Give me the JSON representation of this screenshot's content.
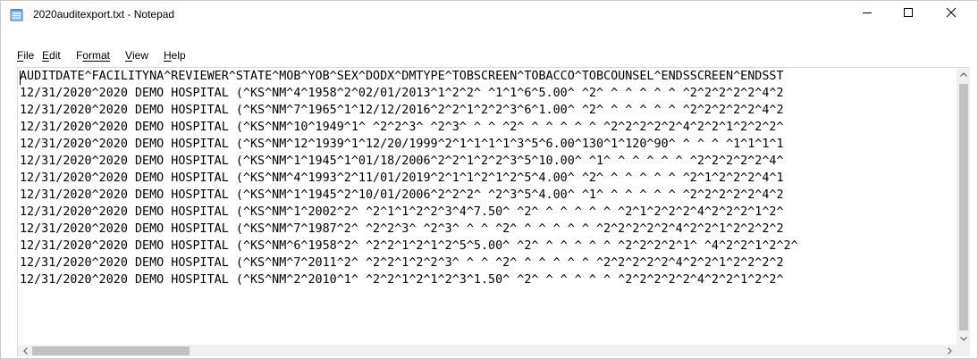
{
  "window": {
    "title": "2020auditexport.txt - Notepad",
    "controls": {
      "minimize": "—",
      "maximize": "☐",
      "close": "✕"
    }
  },
  "menu": {
    "items": [
      {
        "first": "F",
        "rest": "ile"
      },
      {
        "first": "E",
        "rest": "dit"
      },
      {
        "first": "F",
        "rest": "ormat",
        "prefix": ""
      },
      {
        "first": "V",
        "rest": "iew"
      },
      {
        "first": "H",
        "rest": "elp"
      }
    ]
  },
  "document": {
    "lines": [
      "AUDITDATE^FACILITYNA^REVIEWER^STATE^MOB^YOB^SEX^DODX^DMTYPE^TOBSCREEN^TOBACCO^TOBCOUNSEL^ENDSSCREEN^ENDSST",
      "12/31/2020^2020 DEMO HOSPITAL (^KS^NM^4^1958^2^02/01/2013^1^2^2^ ^1^1^6^5.00^ ^2^ ^ ^ ^ ^ ^ ^2^2^2^2^2^4^2",
      "12/31/2020^2020 DEMO HOSPITAL (^KS^NM^7^1965^1^12/12/2016^2^2^1^2^2^3^6^1.00^ ^2^ ^ ^ ^ ^ ^ ^2^2^2^2^2^4^2",
      "12/31/2020^2020 DEMO HOSPITAL (^KS^NM^10^1949^1^ ^2^2^3^ ^2^3^ ^ ^ ^2^ ^ ^ ^ ^ ^ ^2^2^2^2^2^4^2^2^1^2^2^2^",
      "12/31/2020^2020 DEMO HOSPITAL (^KS^NM^12^1939^1^12/20/1999^2^1^1^1^1^3^5^6.00^130^1^120^90^ ^ ^ ^ ^1^1^1^1",
      "12/31/2020^2020 DEMO HOSPITAL (^KS^NM^1^1945^1^01/18/2006^2^2^1^2^2^3^5^10.00^ ^1^ ^ ^ ^ ^ ^ ^2^2^2^2^2^4^",
      "12/31/2020^2020 DEMO HOSPITAL (^KS^NM^4^1993^2^11/01/2019^2^1^1^2^1^2^5^4.00^ ^2^ ^ ^ ^ ^ ^ ^2^1^2^2^2^4^1",
      "12/31/2020^2020 DEMO HOSPITAL (^KS^NM^1^1945^2^10/01/2006^2^2^2^ ^2^3^5^4.00^ ^1^ ^ ^ ^ ^ ^ ^2^2^2^2^2^4^2",
      "12/31/2020^2020 DEMO HOSPITAL (^KS^NM^1^2002^2^ ^2^1^1^2^2^3^4^7.50^ ^2^ ^ ^ ^ ^ ^ ^2^1^2^2^2^4^2^2^2^1^2^",
      "12/31/2020^2020 DEMO HOSPITAL (^KS^NM^7^1987^2^ ^2^2^3^ ^2^3^ ^ ^ ^2^ ^ ^ ^ ^ ^ ^2^2^2^2^2^4^2^2^1^2^2^2^2",
      "12/31/2020^2020 DEMO HOSPITAL (^KS^NM^6^1958^2^ ^2^2^1^2^1^2^5^5.00^ ^2^ ^ ^ ^ ^ ^ ^2^2^2^2^1^ ^4^2^2^1^2^2^",
      "12/31/2020^2020 DEMO HOSPITAL (^KS^NM^7^2011^2^ ^2^2^1^2^2^3^ ^ ^ ^2^ ^ ^ ^ ^ ^ ^2^2^2^2^2^4^2^2^1^2^2^2^2",
      "12/31/2020^2020 DEMO HOSPITAL (^KS^NM^2^2010^1^ ^2^2^1^2^1^2^3^1.50^ ^2^ ^ ^ ^ ^ ^ ^2^2^2^2^2^4^2^2^1^2^2^"
    ]
  },
  "scrollbars": {
    "up_arrow": "▲",
    "down_arrow": "▼",
    "left_arrow": "<",
    "right_arrow": ">"
  }
}
